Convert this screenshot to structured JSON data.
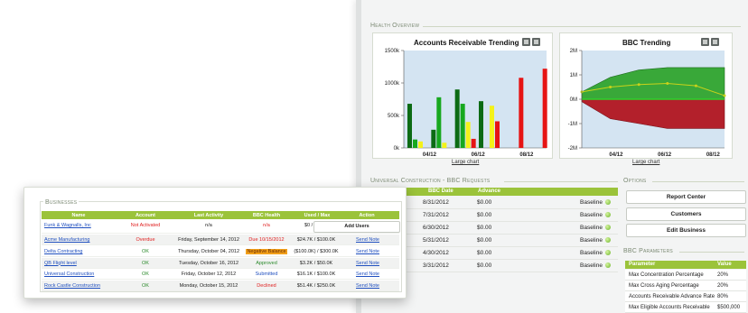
{
  "health": {
    "title": "Health Overview",
    "large_chart_link": "Large chart",
    "colors": {
      "dark_green": "#0c6b14",
      "green": "#17a81f",
      "yellow": "#f4f21a",
      "red": "#e61414",
      "area_green": "#39a839",
      "area_red": "#b3202b",
      "baseline": "#c9d21a"
    }
  },
  "ar_chart": {
    "title": "Accounts Receivable Trending",
    "y_ticks": [
      "1500k",
      "1000k",
      "500k",
      "0k"
    ],
    "x_ticks": [
      "04/12",
      "06/12",
      "08/12"
    ]
  },
  "bbc_chart": {
    "title": "BBC Trending",
    "y_ticks": [
      "2M",
      "1M",
      "0M",
      "-1M",
      "-2M"
    ],
    "x_ticks": [
      "04/12",
      "06/12",
      "08/12"
    ]
  },
  "chart_data": [
    {
      "type": "bar",
      "title": "Accounts Receivable Trending",
      "ylim": [
        0,
        1500
      ],
      "y_unit": "k",
      "x_ticks": [
        "04/12",
        "06/12",
        "08/12"
      ],
      "series": [
        {
          "color": "dark_green",
          "values": [
            680,
            280,
            900,
            720,
            0,
            0
          ]
        },
        {
          "color": "green",
          "values": [
            130,
            780,
            680,
            0,
            0,
            0
          ]
        },
        {
          "color": "yellow",
          "values": [
            100,
            80,
            400,
            650,
            0,
            0
          ]
        },
        {
          "color": "red",
          "values": [
            0,
            0,
            140,
            410,
            1080,
            1220
          ]
        }
      ]
    },
    {
      "type": "area",
      "title": "BBC Trending",
      "ylim": [
        -2,
        2
      ],
      "y_unit": "M",
      "x_ticks": [
        "04/12",
        "06/12",
        "08/12"
      ],
      "upper": [
        0.3,
        0.9,
        1.2,
        1.3,
        1.3,
        1.3
      ],
      "lower": [
        -0.1,
        -0.8,
        -1.0,
        -1.2,
        -1.2,
        -1.2
      ],
      "baseline": [
        0.3,
        0.5,
        0.6,
        0.65,
        0.55,
        0.15
      ]
    }
  ],
  "requests": {
    "title": "Universal Construction - BBC Requests",
    "columns": [
      "BBC Date",
      "Advance"
    ],
    "rows": [
      {
        "date": "8/31/2012",
        "advance": "$0.00",
        "status": "Baseline"
      },
      {
        "date": "7/31/2012",
        "advance": "$0.00",
        "status": "Baseline"
      },
      {
        "date": "6/30/2012",
        "advance": "$0.00",
        "status": "Baseline"
      },
      {
        "date": "5/31/2012",
        "advance": "$0.00",
        "status": "Baseline"
      },
      {
        "date": "4/30/2012",
        "advance": "$0.00",
        "status": "Baseline"
      },
      {
        "date": "3/31/2012",
        "advance": "$0.00",
        "status": "Baseline"
      }
    ]
  },
  "options": {
    "title": "Options",
    "buttons": [
      "Report Center",
      "Customers",
      "Edit Business"
    ]
  },
  "params": {
    "title": "BBC Parameters",
    "columns": [
      "Parameter",
      "Value"
    ],
    "rows": [
      {
        "name": "Max Concentration Percentage",
        "value": "20%"
      },
      {
        "name": "Max Cross Aging Percentage",
        "value": "20%"
      },
      {
        "name": "Accounts Receivable Advance Rate",
        "value": "80%"
      },
      {
        "name": "Max Eligible Accounts Receivable",
        "value": "$500,000"
      }
    ]
  },
  "businesses": {
    "title": "Businesses",
    "columns": [
      "Name",
      "Account",
      "Last Activity",
      "BBC Health",
      "Used / Max",
      "Action"
    ],
    "rows": [
      {
        "name": "Funk & Wagnalls, Inc",
        "account": "Not Activated",
        "activity": "n/a",
        "health": "n/a",
        "used": "$0 / $1.0M",
        "action": "Add Users"
      },
      {
        "name": "Acme Manufacturing",
        "account": "Overdue",
        "activity": "Friday, September 14, 2012",
        "health": "Due 10/15/2012",
        "used": "$24.7K / $100.0K",
        "action": "Send Note"
      },
      {
        "name": "Delta Contracting",
        "account": "OK",
        "activity": "Thursday, October 04, 2012",
        "health": "Negative Balance",
        "used": "($100.0K) / $300.0K",
        "action": "Send Note"
      },
      {
        "name": "QB Flight level",
        "account": "OK",
        "activity": "Tuesday, October 16, 2012",
        "health": "Approved",
        "used": "$3.2K / $50.0K",
        "action": "Send Note"
      },
      {
        "name": "Universal Construction",
        "account": "OK",
        "activity": "Friday, October 12, 2012",
        "health": "Submitted",
        "used": "$16.1K / $100.0K",
        "action": "Send Note"
      },
      {
        "name": "Rock Castle Construction",
        "account": "OK",
        "activity": "Monday, October 15, 2012",
        "health": "Declined",
        "used": "$51.4K / $250.0K",
        "action": "Send Note"
      }
    ]
  }
}
